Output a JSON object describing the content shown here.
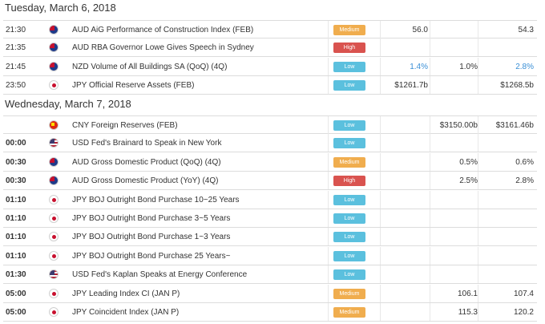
{
  "days": [
    {
      "date": "Tuesday, March 6, 2018",
      "events": [
        {
          "time": "21:30",
          "bold": false,
          "flag": "AUD",
          "event": "AUD AiG Performance of Construction Index (FEB)",
          "importance": "Medium",
          "actual": "56.0",
          "forecast": "",
          "previous": "54.3",
          "actual_blue": false,
          "previous_blue": false
        },
        {
          "time": "21:35",
          "bold": false,
          "flag": "AUD",
          "event": "AUD RBA Governor Lowe Gives Speech in Sydney",
          "importance": "High",
          "actual": "",
          "forecast": "",
          "previous": "",
          "actual_blue": false,
          "previous_blue": false
        },
        {
          "time": "21:45",
          "bold": false,
          "flag": "NZD",
          "event": "NZD Volume of All Buildings SA (QoQ) (4Q)",
          "importance": "Low",
          "actual": "1.4%",
          "forecast": "1.0%",
          "previous": "2.8%",
          "actual_blue": true,
          "previous_blue": true
        },
        {
          "time": "23:50",
          "bold": false,
          "flag": "JPY",
          "event": "JPY Official Reserve Assets (FEB)",
          "importance": "Low",
          "actual": "$1261.7b",
          "forecast": "",
          "previous": "$1268.5b",
          "actual_blue": false,
          "previous_blue": false
        }
      ]
    },
    {
      "date": "Wednesday, March 7, 2018",
      "events": [
        {
          "time": "",
          "bold": false,
          "flag": "CNY",
          "event": "CNY Foreign Reserves (FEB)",
          "importance": "Low",
          "actual": "",
          "forecast": "$3150.00b",
          "previous": "$3161.46b",
          "actual_blue": false,
          "previous_blue": false
        },
        {
          "time": "00:00",
          "bold": true,
          "flag": "USD",
          "event": "USD Fed's Brainard to Speak in New York",
          "importance": "Low",
          "actual": "",
          "forecast": "",
          "previous": "",
          "actual_blue": false,
          "previous_blue": false
        },
        {
          "time": "00:30",
          "bold": true,
          "flag": "AUD",
          "event": "AUD Gross Domestic Product (QoQ) (4Q)",
          "importance": "Medium",
          "actual": "",
          "forecast": "0.5%",
          "previous": "0.6%",
          "actual_blue": false,
          "previous_blue": false
        },
        {
          "time": "00:30",
          "bold": true,
          "flag": "AUD",
          "event": "AUD Gross Domestic Product (YoY) (4Q)",
          "importance": "High",
          "actual": "",
          "forecast": "2.5%",
          "previous": "2.8%",
          "actual_blue": false,
          "previous_blue": false
        },
        {
          "time": "01:10",
          "bold": true,
          "flag": "JPY",
          "event": "JPY BOJ Outright Bond Purchase 10~25 Years",
          "importance": "Low",
          "actual": "",
          "forecast": "",
          "previous": "",
          "actual_blue": false,
          "previous_blue": false
        },
        {
          "time": "01:10",
          "bold": true,
          "flag": "JPY",
          "event": "JPY BOJ Outright Bond Purchase 3~5 Years",
          "importance": "Low",
          "actual": "",
          "forecast": "",
          "previous": "",
          "actual_blue": false,
          "previous_blue": false
        },
        {
          "time": "01:10",
          "bold": true,
          "flag": "JPY",
          "event": "JPY BOJ Outright Bond Purchase 1~3 Years",
          "importance": "Low",
          "actual": "",
          "forecast": "",
          "previous": "",
          "actual_blue": false,
          "previous_blue": false
        },
        {
          "time": "01:10",
          "bold": true,
          "flag": "JPY",
          "event": "JPY BOJ Outright Bond Purchase 25 Years~",
          "importance": "Low",
          "actual": "",
          "forecast": "",
          "previous": "",
          "actual_blue": false,
          "previous_blue": false
        },
        {
          "time": "01:30",
          "bold": true,
          "flag": "USD",
          "event": "USD Fed's Kaplan Speaks at Energy Conference",
          "importance": "Low",
          "actual": "",
          "forecast": "",
          "previous": "",
          "actual_blue": false,
          "previous_blue": false
        },
        {
          "time": "05:00",
          "bold": true,
          "flag": "JPY",
          "event": "JPY Leading Index CI (JAN P)",
          "importance": "Medium",
          "actual": "",
          "forecast": "106.1",
          "previous": "107.4",
          "actual_blue": false,
          "previous_blue": false
        },
        {
          "time": "05:00",
          "bold": true,
          "flag": "JPY",
          "event": "JPY Coincident Index (JAN P)",
          "importance": "Medium",
          "actual": "",
          "forecast": "115.3",
          "previous": "120.2",
          "actual_blue": false,
          "previous_blue": false
        }
      ]
    }
  ],
  "colors": {
    "low": "#5bc0de",
    "medium": "#f0ad4e",
    "high": "#d9534f",
    "link_blue": "#3a8fd6"
  }
}
